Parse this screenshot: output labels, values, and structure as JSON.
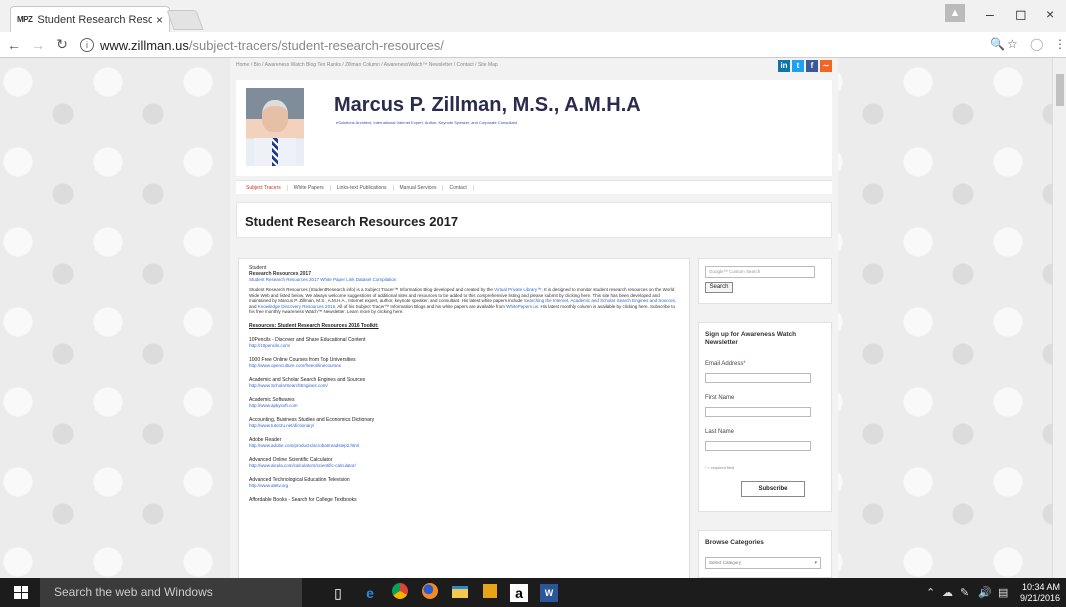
{
  "browser": {
    "tab_title": "Student Research Resou",
    "tab_favicon": "MPZ",
    "tab_close": "×",
    "url_host": "www.zillman.us",
    "url_path": "/subject-tracers/student-research-resources/",
    "profile_icon": "person-icon",
    "win_minimize": "–",
    "win_maximize": "◻",
    "win_close": "×"
  },
  "site": {
    "top_links": "Home / Bio / Awareness Watch Blog Ten Ranks / Zillman Column / AwarenessWatch™ Newsletter / Contact / Site Map",
    "title": "Marcus P. Zillman, M.S., A.M.H.A",
    "tagline": "eSolutions Architect, International Internet Expert, Author, Keynote Speaker, and Corporate Consultant",
    "menu": [
      "Subject Tracers",
      "White Papers",
      "Links-text Publications",
      "Manual Services",
      "Contact"
    ],
    "page_title": "Student Research Resources 2017"
  },
  "content": {
    "heading_1": "Student",
    "heading_2": "Research Resources 2017",
    "sub_link": "Student Research Resources 2017 White Paper Link Dataset Compilation",
    "para_1": "Student Research Resources (StudentResearch.info) is a Subject Tracer™ Information Blog developed and created by the",
    "para_link_1": "Virtual Private Library™.",
    "para_2": "It is designed to monitor student research resources on the World Wide Web and listed below. We always welcome suggestions of additional sites and resources to be added to this comprehensive listing and please submit by clicking here. This site has been developed and maintained by Marcus P. Zillman, M.S., A.M.H.A., Internet expert, author, keynote speaker, and consultant. His latest white papers include",
    "para_link_2": "Searching the Internet, Academic and Scholar Search Engines and Sources,",
    "para_3": "and",
    "para_link_3": "Knowledge Discovery Resources 2016.",
    "para_4": "All of his Subject Tracer™ Information Blogs and his white papers are available from",
    "para_link_4": "WhitePapers.us.",
    "para_5": "His latest monthly column is available by clicking here. Subscribe to his free monthly Awareness Watch™ Newsletter. Learn more by clicking here.",
    "toolkit_title": "Resources: Student Research Resources 2016 Toolkit:",
    "resources": [
      {
        "name": "10Pencils - Discover and Share Educational Content",
        "url": "http://10pencils.com/"
      },
      {
        "name": "1000 Free Online Courses from Top Universities",
        "url": "http://www.openculture.com/freeonlinecourses"
      },
      {
        "name": "Academic and Scholar Search Engines and Sources",
        "url": "http://www.ScholarSearchEngines.com/"
      },
      {
        "name": "Academic Softwares",
        "url": "http://www.apkysoft.com"
      },
      {
        "name": "Accounting, Business Studies and Economics Dictionary",
        "url": "http://www.tutor2u.net/dictionary/"
      },
      {
        "name": "Adobe Reader",
        "url": "http://www.adobe.com/products/acrobat/readstep2.html"
      },
      {
        "name": "Advanced Online Scientific Calculator",
        "url": "http://www.alcula.com/calculators/scientific-calculator/"
      },
      {
        "name": "Advanced Technological Education Television",
        "url": "http://www.atetv.org"
      },
      {
        "name": "Affordable Books - Search for College Textbooks",
        "url": ""
      }
    ]
  },
  "sidebar": {
    "search_placeholder": "Google™ Custom Search",
    "search_button": "Search",
    "newsletter_title": "Sign up for Awareness Watch Newsletter",
    "email_label": "Email Address",
    "email_required_mark": "*",
    "first_name_label": "First Name",
    "last_name_label": "Last Name",
    "required_note": "* = required field",
    "subscribe_button": "Subscribe",
    "categories_title": "Browse Categories",
    "categories_select": "Select Category"
  },
  "taskbar": {
    "search_placeholder": "Search the web and Windows",
    "time": "10:34 AM",
    "date": "9/21/2016"
  },
  "colors": {
    "accent_red": "#c0392b",
    "link_blue": "#3366cc",
    "title_navy": "#2b2b4f",
    "linkedin": "#0e76a8",
    "twitter": "#1da1f2",
    "facebook": "#3b5998",
    "rss": "#f26522"
  }
}
